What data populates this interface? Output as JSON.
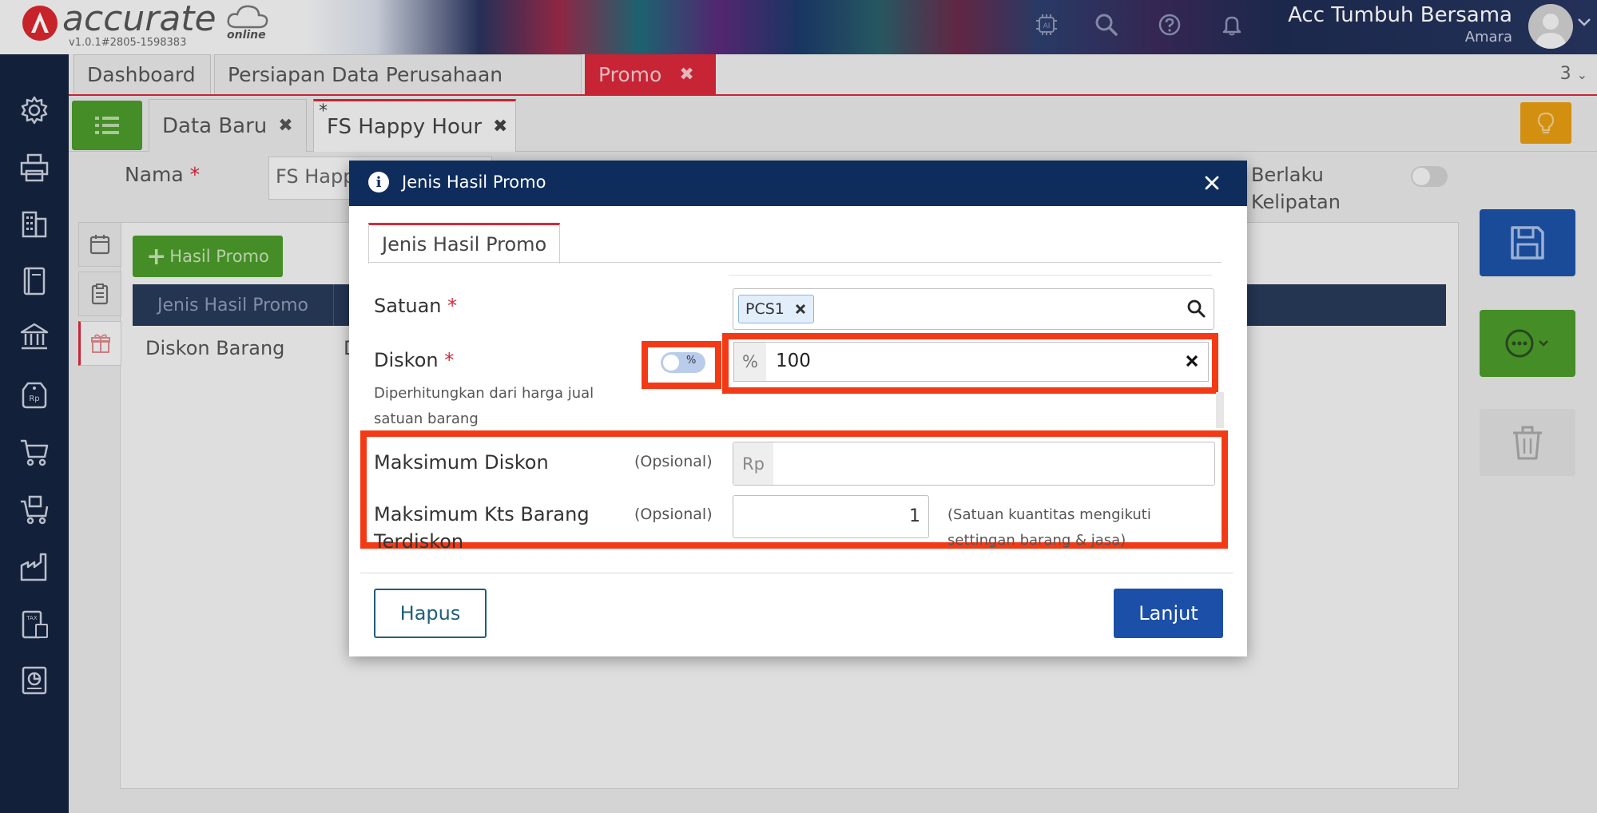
{
  "header": {
    "logo_text": "accurate",
    "logo_sub": "online",
    "version": "v1.0.1#2805-1598383",
    "ai_label": "AI",
    "company": "Acc Tumbuh Bersama",
    "user": "Amara"
  },
  "tabs_main": [
    {
      "label": "Dashboard"
    },
    {
      "label": "Persiapan Data Perusahaan"
    },
    {
      "label": "Promo",
      "close": "✖"
    }
  ],
  "tabs_count": "3",
  "tabs_sub": [
    {
      "label": "Data Baru",
      "close": "✖"
    },
    {
      "label": "FS Happy Hour",
      "close": "✖",
      "modified": "*"
    }
  ],
  "form": {
    "nama_label": "Nama",
    "required_mark": "*",
    "nama_value": "FS Happy Hour",
    "berlaku_label_1": "Berlaku",
    "berlaku_label_2": "Kelipatan",
    "hasil_promo_btn": "Hasil Promo",
    "table_header": "Jenis Hasil Promo",
    "table_row": "Diskon Barang",
    "table_row_col2": "D"
  },
  "modal": {
    "title": "Jenis Hasil Promo",
    "info_icon": "i",
    "tab": "Jenis Hasil Promo",
    "satuan_label": "Satuan",
    "satuan_chip": "PCS1",
    "diskon_label": "Diskon",
    "diskon_hint_1": "Diperhitungkan dari harga jual",
    "diskon_hint_2": "satuan barang",
    "diskon_toggle": "%",
    "diskon_addon": "%",
    "diskon_value": "100",
    "maks_diskon_label": "Maksimum Diskon",
    "optional": "(Opsional)",
    "rp_addon": "Rp",
    "maks_kts_label_1": "Maksimum Kts Barang",
    "maks_kts_label_2": "Terdiskon",
    "maks_kts_value": "1",
    "kts_hint_1": "(Satuan kuantitas mengikuti",
    "kts_hint_2": "settingan barang & jasa)",
    "btn_hapus": "Hapus",
    "btn_lanjut": "Lanjut"
  },
  "colors": {
    "brand_red": "#d8283a",
    "navy": "#0f2d5c",
    "primary_blue": "#1b4fa8",
    "green": "#4b9a2a",
    "highlight": "#f23a17"
  }
}
